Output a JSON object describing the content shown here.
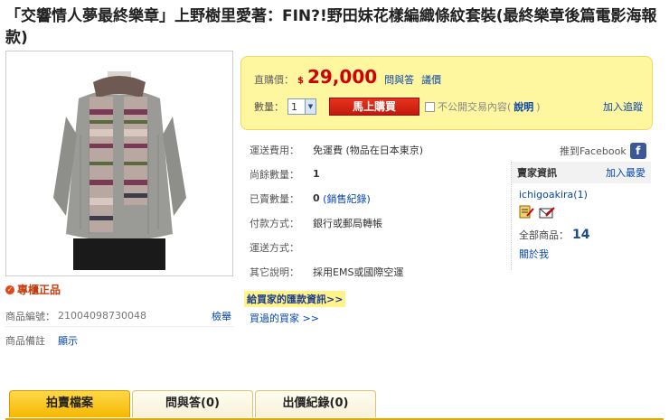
{
  "title": "「交響情人夢最終樂章」上野樹里愛著：FIN?!野田妹花樣編織條紋套裝(最終樂章後篇電影海報款)",
  "official_label": "專櫃正品",
  "item_meta": {
    "id_label": "商品編號：",
    "id_value": "21004098730048",
    "report_label": "檢舉",
    "note_label": "商品備註",
    "note_link": "顯示"
  },
  "purchase": {
    "price_label": "直購價：",
    "currency": "$",
    "price": "29,000",
    "qa_link": "問與答",
    "bargain_link": "議價",
    "qty_label": "數量：",
    "qty_value": "1",
    "buy_button": "馬上購買",
    "private_label": "不公開交易內容(",
    "private_link": "說明",
    "private_close": ")",
    "watch_link": "加入追蹤"
  },
  "details": [
    {
      "label": "運送費用：",
      "value": "免運費 (物品在日本東京)"
    },
    {
      "label": "尚餘數量：",
      "value": "1"
    },
    {
      "label": "已賣數量：",
      "value": "0",
      "link": "(銷售紀錄)"
    },
    {
      "label": "付款方式：",
      "value": "銀行或郵局轉帳"
    },
    {
      "label": "運送方式：",
      "value": ""
    },
    {
      "label": "其它說明：",
      "value": "採用EMS或國際空運"
    }
  ],
  "facebook_label": "推到Facebook",
  "seller": {
    "heading": "賣家資訊",
    "favorite_link": "加入最愛",
    "name": "ichigoakira(1)",
    "total_label": "全部商品：",
    "total_value": "14",
    "about_link": "關於我"
  },
  "remit_link": "給買家的匯款資訊>>",
  "bought_link": "買過的買家 >>",
  "tabs": [
    {
      "label": "拍賣檔案"
    },
    {
      "label": "問與答(0)"
    },
    {
      "label": "出價紀錄(0)"
    }
  ],
  "colors": {
    "price_red": "#d00000",
    "link_blue": "#0645ad",
    "panel_yellow": "#fff6a0",
    "tab_active": "#f5b800"
  }
}
